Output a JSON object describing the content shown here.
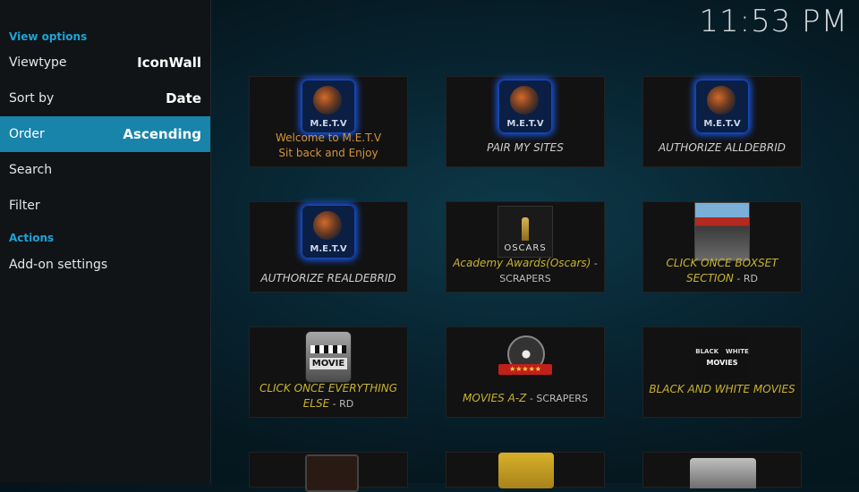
{
  "sidebar": {
    "view_options_heading": "View options",
    "items": [
      {
        "label": "Viewtype",
        "value": "IconWall"
      },
      {
        "label": "Sort by",
        "value": "Date"
      },
      {
        "label": "Order",
        "value": "Ascending"
      },
      {
        "label": "Search",
        "value": ""
      },
      {
        "label": "Filter",
        "value": ""
      }
    ],
    "actions_heading": "Actions",
    "addon_settings": "Add-on settings"
  },
  "clock": "11:53 PM",
  "tiles": [
    {
      "line1": "Welcome to M.E.T.V",
      "line2": "Sit back and Enjoy",
      "icon": "metv-logo-icon"
    },
    {
      "title": "PAIR MY SITES",
      "icon": "metv-logo-icon"
    },
    {
      "title": "AUTHORIZE ALLDEBRID",
      "icon": "metv-logo-icon"
    },
    {
      "title": "AUTHORIZE REALDEBRID",
      "icon": "metv-logo-icon"
    },
    {
      "title": "Academy Awards(Oscars)",
      "suffix": " - SCRAPERS",
      "icon": "oscars-icon"
    },
    {
      "title": "CLICK ONCE BOXSET SECTION",
      "suffix": " - RD",
      "icon": "boxset-poster-icon"
    },
    {
      "title": "CLICK ONCE EVERYTHING ELSE",
      "suffix": " - RD",
      "icon": "movie-clapper-icon"
    },
    {
      "title": "MOVIES   A-Z",
      "suffix": " - SCRAPERS",
      "icon": "film-reel-icon"
    },
    {
      "title": "BLACK AND WHITE MOVIES",
      "icon": "black-white-movies-icon"
    }
  ],
  "icon_texts": {
    "metv": "M.E.T.V",
    "oscars": "OSCARS",
    "movie": "MOVIE",
    "bw_black": "BLACK",
    "bw_white": "WHITE",
    "bw_movies": "MOVIES"
  },
  "colors": {
    "accent": "#1fa2d6",
    "selected_row": "#1984a9",
    "tile_title_yellow": "#c9b32e",
    "tile_title_orange": "#d4933d"
  }
}
